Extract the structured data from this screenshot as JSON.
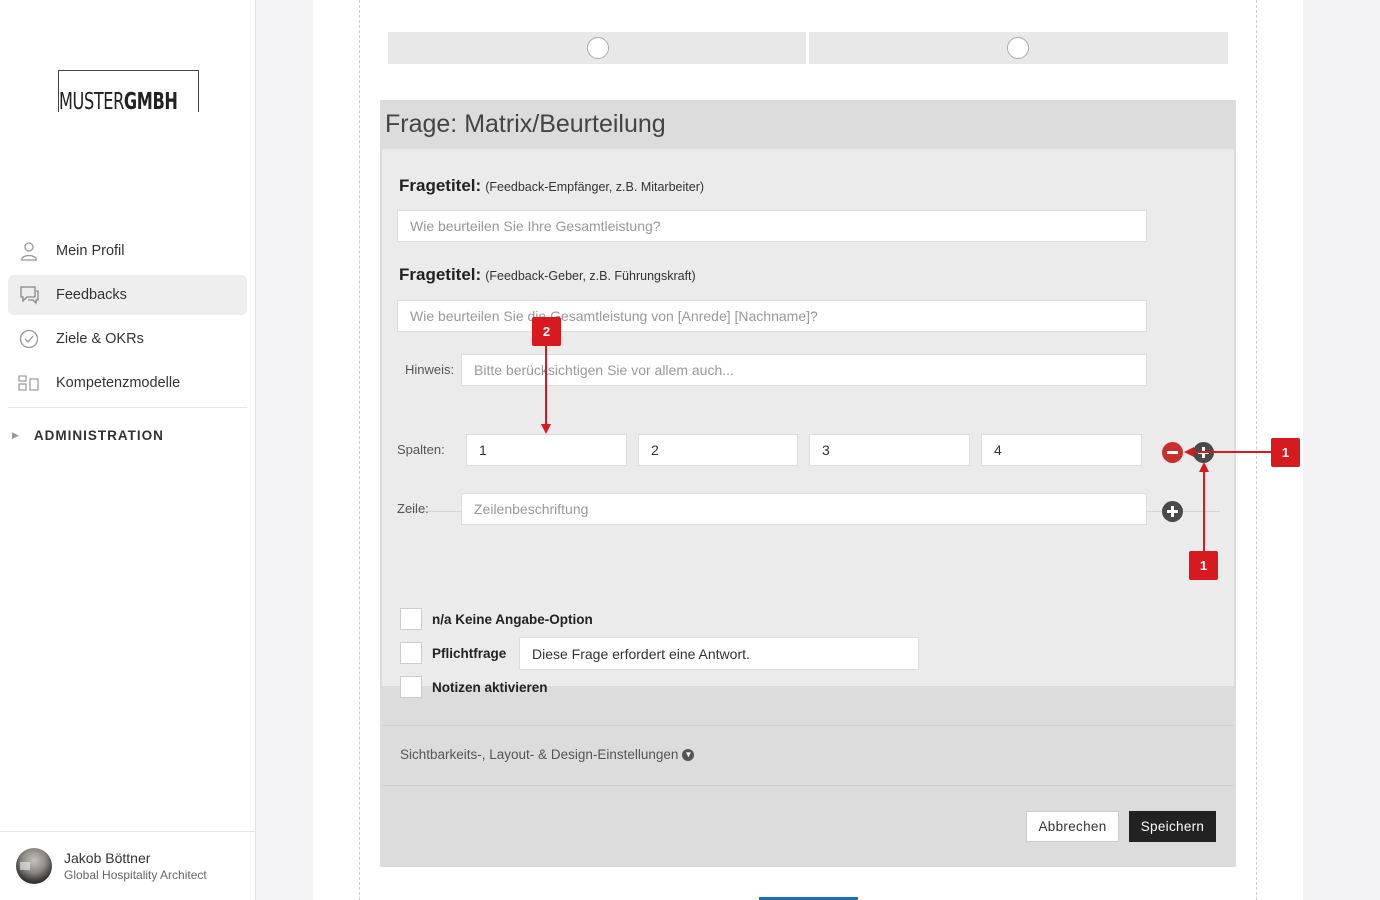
{
  "sidebar": {
    "logo": {
      "part1": "MUSTER",
      "part2": "GMBH"
    },
    "nav": [
      {
        "label": "Mein Profil",
        "icon": "user-icon"
      },
      {
        "label": "Feedbacks",
        "icon": "chat-icon",
        "active": true
      },
      {
        "label": "Ziele & OKRs",
        "icon": "check-circle-icon"
      },
      {
        "label": "Kompetenzmodelle",
        "icon": "grid-icon"
      }
    ],
    "admin_label": "ADMINISTRATION",
    "user": {
      "name": "Jakob Böttner",
      "role": "Global Hospitality Architect"
    }
  },
  "question": {
    "header": "Frage: Matrix/Beurteilung",
    "title1_label": "Fragetitel:",
    "title1_hint": "(Feedback-Empfänger, z.B. Mitarbeiter)",
    "title1_placeholder": "Wie beurteilen Sie Ihre Gesamtleistung?",
    "title2_label": "Fragetitel:",
    "title2_hint": "(Feedback-Geber, z.B. Führungskraft)",
    "title2_placeholder": "Wie beurteilen Sie die Gesamtleistung von [Anrede] [Nachname]?",
    "hint_label": "Hinweis:",
    "hint_placeholder": "Bitte berücksichtigen Sie vor allem auch...",
    "columns_label": "Spalten:",
    "columns": [
      "1",
      "2",
      "3",
      "4"
    ],
    "row_label": "Zeile:",
    "row_placeholder": "Zeilenbeschriftung",
    "options": {
      "na_label": "n/a Keine Angabe-Option",
      "required_label": "Pflichtfrage",
      "required_text": "Diese Frage erfordert eine Antwort.",
      "notes_label": "Notizen aktivieren"
    },
    "settings_label": "Sichtbarkeits-, Layout- & Design-Einstellungen",
    "cancel_label": "Abbrechen",
    "save_label": "Speichern"
  },
  "annotations": {
    "badge_1": "1",
    "badge_2": "2"
  },
  "colors": {
    "accent_red": "#d71920",
    "save_bg": "#222222",
    "minus_red": "#c92f2f"
  }
}
